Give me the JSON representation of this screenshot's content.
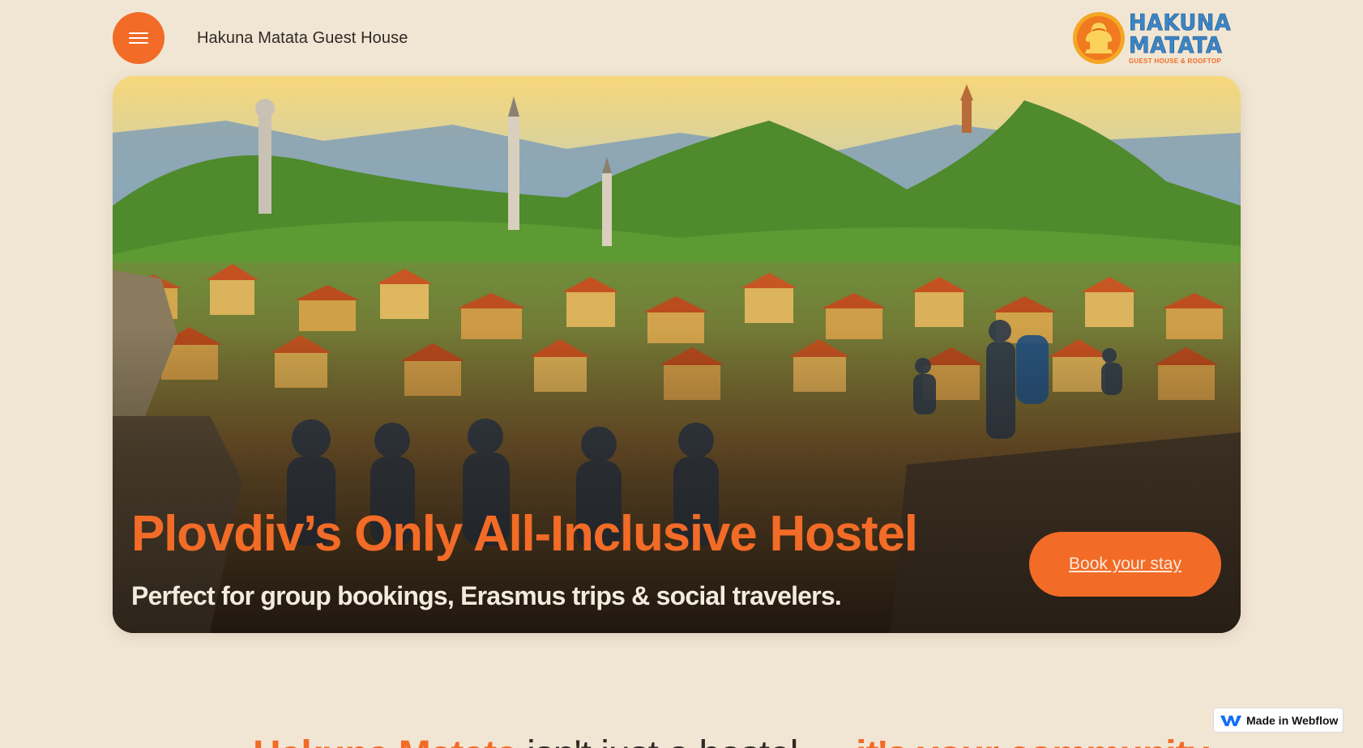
{
  "header": {
    "menu_icon": "hamburger-icon",
    "site_title": "Hakuna Matata Guest House",
    "logo": {
      "line1": "HAKUNA",
      "line2": "MATATA",
      "tagline": "GUEST HOUSE & ROOFTOP",
      "icon": "sun-figure-logo-icon"
    }
  },
  "hero": {
    "headline": "Plovdiv’s Only All-Inclusive Hostel",
    "subline": "Perfect for group bookings, Erasmus trips & social travelers.",
    "cta_label": "Book your stay"
  },
  "next_section": {
    "heading_accent": "Hakuna Matata",
    "heading_middle": " isn't just a hostel — ",
    "heading_accent2": "it's your community"
  },
  "badge": {
    "label": "Made in Webflow",
    "icon": "webflow-icon"
  },
  "colors": {
    "accent": "#f26b27",
    "background": "#f1e6d4",
    "logo_blue": "#3a86c7"
  }
}
